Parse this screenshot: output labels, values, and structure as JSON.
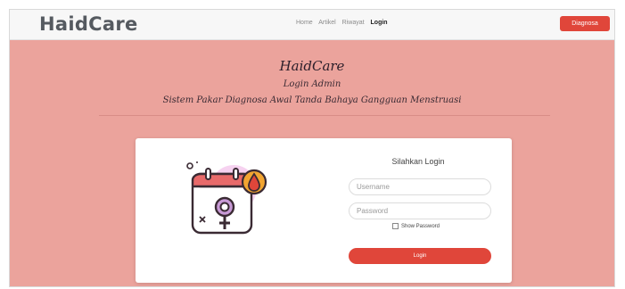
{
  "navbar": {
    "brand": "HaidCare",
    "links": [
      "Home",
      "Artikel",
      "Riwayat",
      "Login"
    ],
    "active_link": "Login",
    "cta_label": "Diagnosa"
  },
  "hero": {
    "title": "HaidCare",
    "subtitle": "Login Admin",
    "description": "Sistem Pakar Diagnosa Awal Tanda Bahaya Gangguan Menstruasi"
  },
  "login_card": {
    "heading": "Silahkan Login",
    "username_placeholder": "Username",
    "password_placeholder": "Password",
    "show_password_label": "Show Password",
    "login_button_label": "Login"
  },
  "colors": {
    "page_background": "#eba39c",
    "accent": "#e0463a",
    "navbar_background": "#f7f7f7"
  },
  "icons": [
    "calendar-female-symbol-icon",
    "blood-drop-icon",
    "checkbox-icon"
  ]
}
